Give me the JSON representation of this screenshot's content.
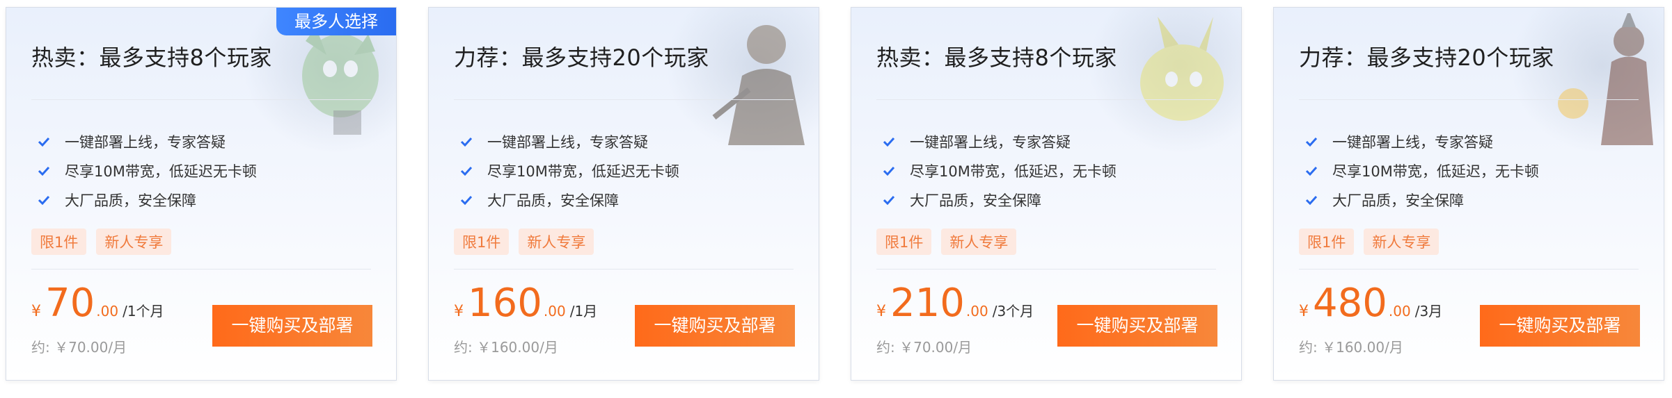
{
  "colors": {
    "accent": "#f26b1d",
    "check": "#2a6cf0",
    "ribbon": "#2a6cf0",
    "tag_bg": "#fde9e1"
  },
  "cards": [
    {
      "ribbon": "最多人选择",
      "title": "热卖：最多支持8个玩家",
      "features": [
        "一键部署上线，专家答疑",
        "尽享10M带宽，低延迟无卡顿",
        "大厂品质，安全保障"
      ],
      "tags": [
        "限1件",
        "新人专享"
      ],
      "currency": "¥",
      "price_int": "70",
      "price_dec": ".00",
      "period": "/1个月",
      "approx": "约: ￥70.00/月",
      "button": "一键购买及部署",
      "art_icon": "creature-art-icon"
    },
    {
      "title": "力荐：最多支持20个玩家",
      "features": [
        "一键部署上线，专家答疑",
        "尽享10M带宽，低延迟无卡顿",
        "大厂品质，安全保障"
      ],
      "tags": [
        "限1件",
        "新人专享"
      ],
      "currency": "¥",
      "price_int": "160",
      "price_dec": ".00",
      "period": "/1月",
      "approx": "约: ￥160.00/月",
      "button": "一键购买及部署",
      "art_icon": "warrior-art-icon"
    },
    {
      "title": "热卖：最多支持8个玩家",
      "features": [
        "一键部署上线，专家答疑",
        "尽享10M带宽，低延迟，无卡顿",
        "大厂品质，安全保障"
      ],
      "tags": [
        "限1件",
        "新人专享"
      ],
      "currency": "¥",
      "price_int": "210",
      "price_dec": ".00",
      "period": "/3个月",
      "approx": "约: ￥70.00/月",
      "button": "一键购买及部署",
      "art_icon": "creature-art-icon"
    },
    {
      "title": "力荐：最多支持20个玩家",
      "features": [
        "一键部署上线，专家答疑",
        "尽享10M带宽，低延迟，无卡顿",
        "大厂品质，安全保障"
      ],
      "tags": [
        "限1件",
        "新人专享"
      ],
      "currency": "¥",
      "price_int": "480",
      "price_dec": ".00",
      "period": "/3月",
      "approx": "约: ￥160.00/月",
      "button": "一键购买及部署",
      "art_icon": "warrior-art-icon"
    }
  ]
}
